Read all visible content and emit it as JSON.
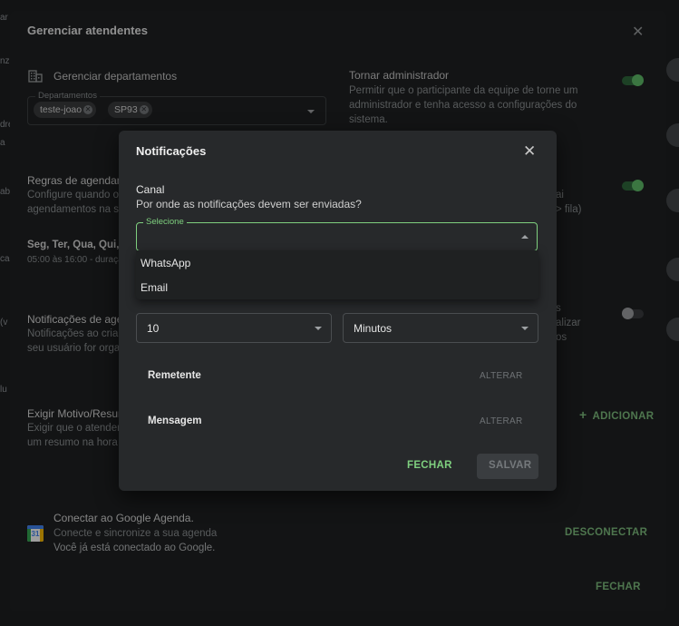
{
  "background_peek": {
    "left": [
      "ar",
      "nz",
      "dre",
      "a",
      "abr",
      "cas",
      "(v",
      "lu"
    ]
  },
  "outer": {
    "title": "Gerenciar atendentes",
    "dept_label": "Gerenciar departamentos",
    "dept_field_legend": "Departamentos",
    "dept_chips": [
      "teste-joao",
      "SP93"
    ],
    "admin_title": "Tornar administrador",
    "admin_desc": "Permitir que o participante da equipe de torne um administrador e tenha acesso a configurações do sistema.",
    "rules_title": "Regras de agendam",
    "rules_desc_1": "Configure quando o",
    "rules_desc_2": "agendamentos na s",
    "rules_right_1": "ai",
    "rules_right_2": "> fila)",
    "days": "Seg, Ter, Qua, Qui, S",
    "hours": "05:00 às 16:00 - duraçã",
    "notif_title": "Notificações de age",
    "notif_desc_1": "Notificações ao cria",
    "notif_desc_2": "seu usuário for orga",
    "notif_right_1": "s",
    "notif_right_2": "alizar",
    "notif_right_3": "os",
    "reason_title": "Exigir Motivo/Resur",
    "reason_desc_1": "Exigir que o atender",
    "reason_desc_2": "um resumo na hora",
    "add_label": "ADICIONAR",
    "google_title": "Conectar ao Google Agenda.",
    "google_desc": "Conecte e sincronize a sua agenda",
    "google_status": "Você já está conectado ao Google.",
    "calendar_day": "31",
    "disconnect_label": "DESCONECTAR",
    "close_label": "FECHAR"
  },
  "modal": {
    "title": "Notificações",
    "canal_label": "Canal",
    "canal_desc": "Por onde as notificações devem ser enviadas?",
    "select_legend": "Selecione",
    "options": [
      "WhatsApp",
      "Email"
    ],
    "amount_value": "10",
    "unit_value": "Minutos",
    "sender_label": "Remetente",
    "message_label": "Mensagem",
    "change_label": "ALTERAR",
    "close_label": "FECHAR",
    "save_label": "SALVAR"
  },
  "colors": {
    "accent_green": "#7fd07f",
    "google_blue": "#4285f4"
  }
}
